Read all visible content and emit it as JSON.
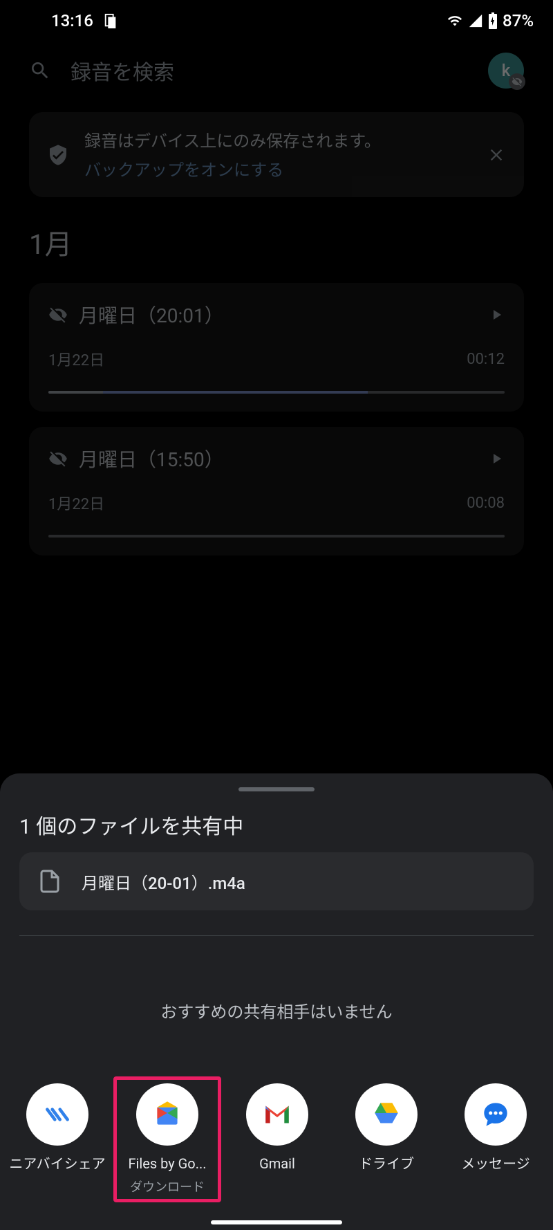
{
  "status": {
    "time": "13:16",
    "battery": "87%"
  },
  "search": {
    "placeholder": "録音を検索",
    "avatar_letter": "k"
  },
  "info_card": {
    "message": "録音はデバイス上にのみ保存されます。",
    "link": "バックアップをオンにする"
  },
  "section": {
    "month": "1月"
  },
  "recordings": [
    {
      "title": "月曜日（20:01）",
      "date": "1月22日",
      "duration": "00:12",
      "progress": 70
    },
    {
      "title": "月曜日（15:50）",
      "date": "1月22日",
      "duration": "00:08",
      "progress": 0
    }
  ],
  "share_sheet": {
    "title": "1 個のファイルを共有中",
    "file_name": "月曜日（20-01）.m4a",
    "no_suggestions": "おすすめの共有相手はいません",
    "apps": [
      {
        "label": "ニアバイシェア",
        "sublabel": ""
      },
      {
        "label": "Files by Go...",
        "sublabel": "ダウンロード"
      },
      {
        "label": "Gmail",
        "sublabel": ""
      },
      {
        "label": "ドライブ",
        "sublabel": ""
      },
      {
        "label": "メッセージ",
        "sublabel": ""
      }
    ]
  }
}
